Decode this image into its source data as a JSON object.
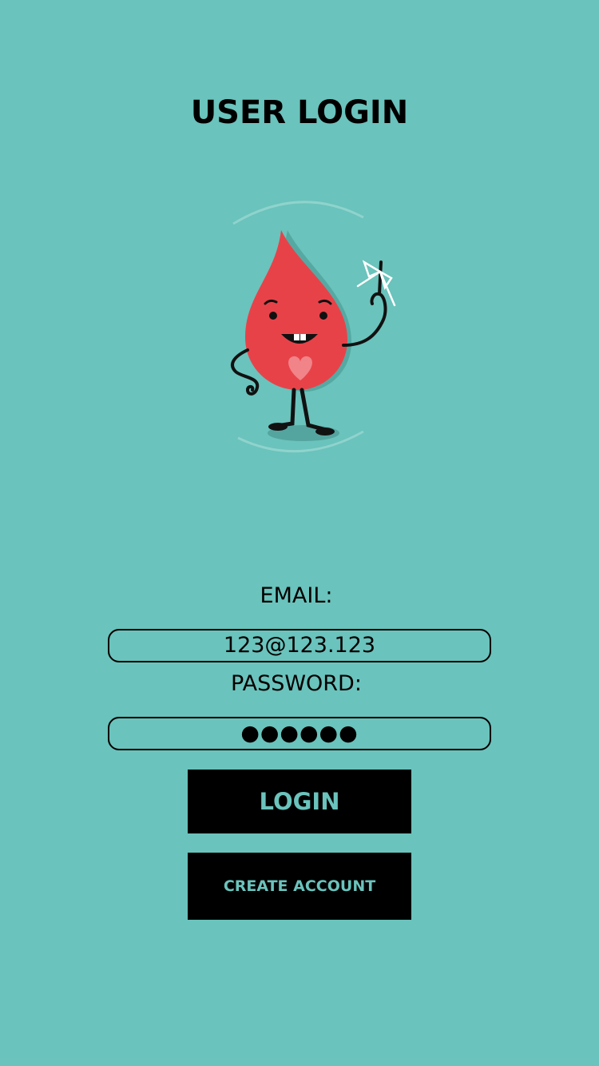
{
  "page": {
    "title": "USER LOGIN"
  },
  "mascot": {
    "icon": "blood-drop-mascot-icon"
  },
  "form": {
    "email_label": "EMAIL:",
    "email_value": "123@123.123",
    "password_label": "PASSWORD:",
    "password_value": "●●●●●●"
  },
  "buttons": {
    "login_label": "LOGIN",
    "create_account_label": "CREATE ACCOUNT"
  },
  "colors": {
    "background": "#6ac3bc",
    "button_bg": "#000000",
    "button_text": "#6ac3bc",
    "drop": "#e84249",
    "heart": "#f08489"
  }
}
